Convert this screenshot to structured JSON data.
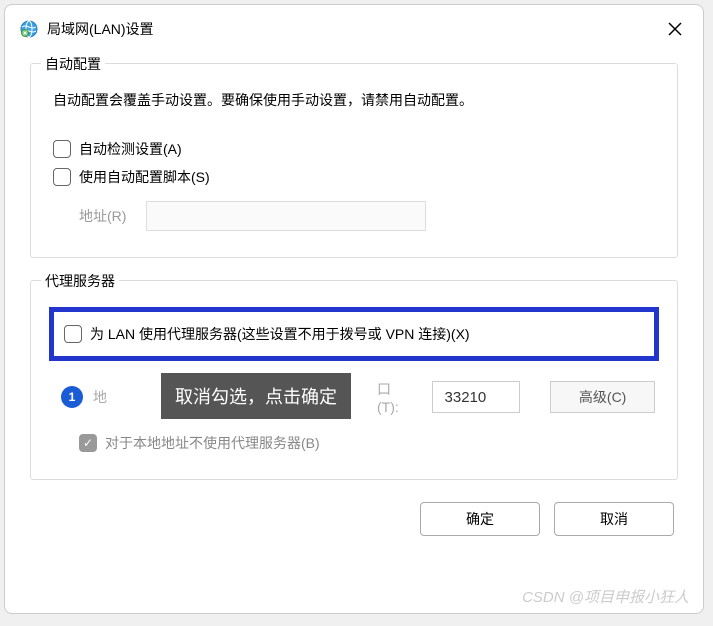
{
  "titlebar": {
    "title": "局域网(LAN)设置"
  },
  "auto_config": {
    "group_label": "自动配置",
    "desc": "自动配置会覆盖手动设置。要确保使用手动设置，请禁用自动配置。",
    "auto_detect_label": "自动检测设置(A)",
    "use_script_label": "使用自动配置脚本(S)",
    "address_label": "地址(R)"
  },
  "proxy": {
    "group_label": "代理服务器",
    "use_proxy_label": "为 LAN 使用代理服务器(这些设置不用于拨号或 VPN 连接)(X)",
    "callout_badge": "1",
    "callout_text": "取消勾选，点击确定",
    "addr_frag_left": "地",
    "port_frag": "口(T):",
    "port_value": "33210",
    "advanced_label": "高级(C)",
    "bypass_local_label": "对于本地地址不使用代理服务器(B)"
  },
  "buttons": {
    "ok": "确定",
    "cancel": "取消"
  },
  "watermark": "CSDN @项目申报小狂人"
}
